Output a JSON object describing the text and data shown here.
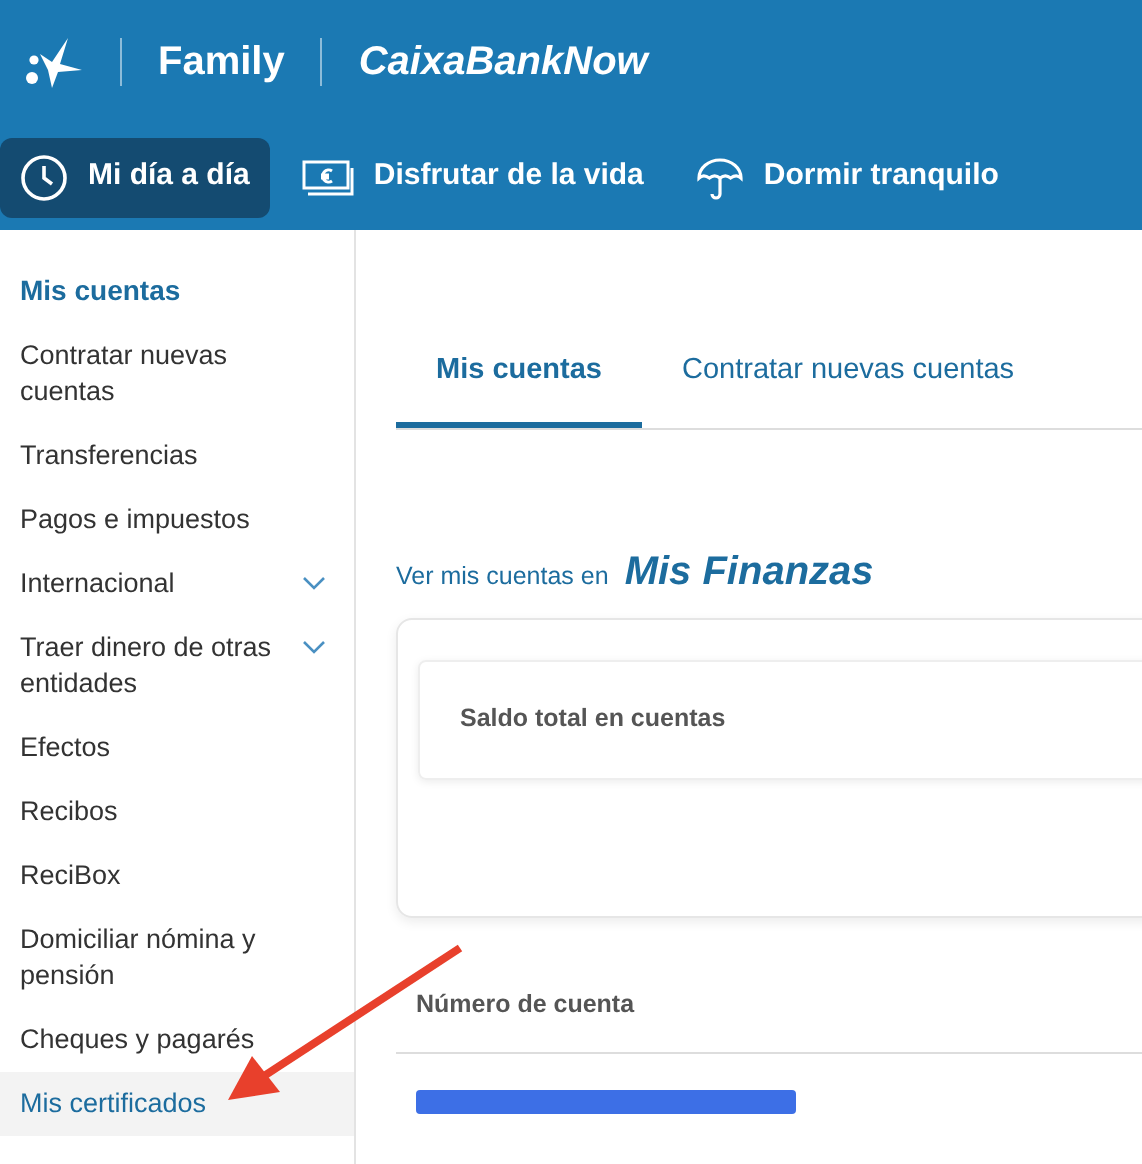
{
  "header": {
    "brand_sections": [
      "Family",
      "CaixaBankNow"
    ],
    "nav": [
      {
        "label": "Mi día a día",
        "selected": true
      },
      {
        "label": "Disfrutar de la vida",
        "selected": false
      },
      {
        "label": "Dormir tranquilo",
        "selected": false
      }
    ]
  },
  "sidebar": {
    "title": "Mis cuentas",
    "items": [
      {
        "label": "Contratar nuevas cuentas",
        "expandable": false,
        "selected": false
      },
      {
        "label": "Transferencias",
        "expandable": false,
        "selected": false
      },
      {
        "label": "Pagos e impuestos",
        "expandable": false,
        "selected": false
      },
      {
        "label": "Internacional",
        "expandable": true,
        "selected": false
      },
      {
        "label": "Traer dinero de otras entidades",
        "expandable": true,
        "selected": false
      },
      {
        "label": "Efectos",
        "expandable": false,
        "selected": false
      },
      {
        "label": "Recibos",
        "expandable": false,
        "selected": false
      },
      {
        "label": "ReciBox",
        "expandable": false,
        "selected": false
      },
      {
        "label": "Domiciliar nómina y pensión",
        "expandable": false,
        "selected": false
      },
      {
        "label": "Cheques y pagarés",
        "expandable": false,
        "selected": false
      },
      {
        "label": "Mis certificados",
        "expandable": false,
        "selected": true
      }
    ]
  },
  "tabs": [
    {
      "label": "Mis cuentas",
      "selected": true
    },
    {
      "label": "Contratar nuevas cuentas",
      "selected": false
    }
  ],
  "finanzas_link": {
    "prefix": "Ver mis cuentas en",
    "name": "Mis Finanzas"
  },
  "balance_card": {
    "title": "Saldo total en cuentas"
  },
  "accounts_table": {
    "columns": [
      "Número de cuenta"
    ],
    "rows_redacted": true
  }
}
